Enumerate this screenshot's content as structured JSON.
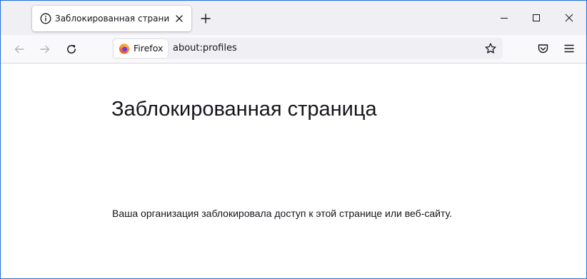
{
  "tab": {
    "title": "Заблокированная страница",
    "info_icon": "info-icon",
    "close_icon": "close-icon"
  },
  "toolbar": {
    "identity_label": "Firefox",
    "url": "about:profiles",
    "icons": [
      "back-arrow-icon",
      "forward-arrow-icon",
      "reload-icon",
      "star-icon",
      "pocket-icon",
      "hamburger-menu-icon"
    ]
  },
  "window_controls": [
    "minimize-icon",
    "maximize-icon",
    "close-icon"
  ],
  "page": {
    "title": "Заблокированная страница",
    "description": "Ваша организация заблокировала доступ к этой странице или веб-сайту."
  },
  "colors": {
    "window_border": "#1f6fd6",
    "tabbar_bg": "#f0f0f4",
    "toolbar_bg": "#f9f9fb",
    "text": "#15141a",
    "disabled_icon": "#b5b5bb"
  }
}
